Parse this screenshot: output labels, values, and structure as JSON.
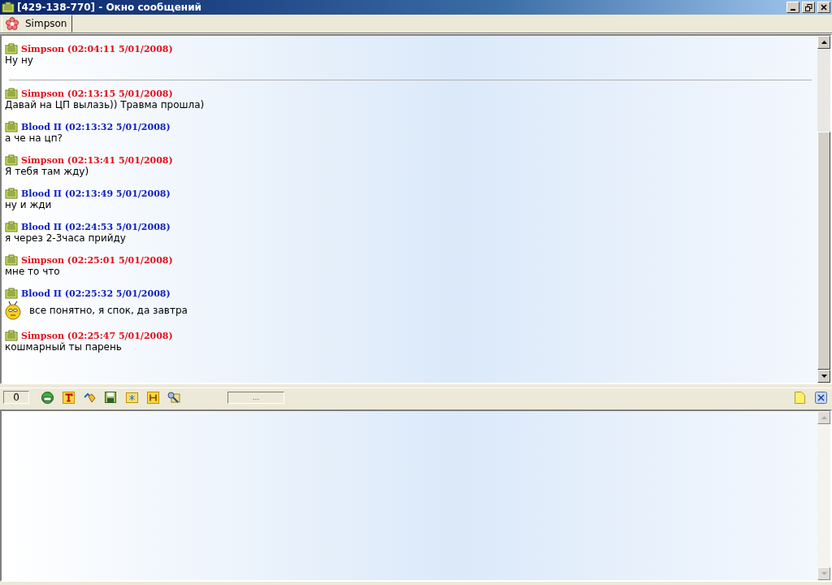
{
  "window": {
    "title": "[429-138-770] - Окно сообщений"
  },
  "tabs": [
    {
      "label": "Simpson",
      "selected": true
    }
  ],
  "messages": [
    {
      "kind": "message",
      "author": "Simpson (02:04:11 5/01/2008)",
      "color": "#e0101a",
      "text": "Ну ну",
      "smiley": false
    },
    {
      "kind": "divider"
    },
    {
      "kind": "message",
      "author": "Simpson (02:13:15 5/01/2008)",
      "color": "#e0101a",
      "text": "Давай на ЦП вылазь)) Травма прошла)",
      "smiley": false
    },
    {
      "kind": "message",
      "author": "Blood II (02:13:32 5/01/2008)",
      "color": "#1020c0",
      "text": "а че на цп?",
      "smiley": false
    },
    {
      "kind": "message",
      "author": "Simpson (02:13:41 5/01/2008)",
      "color": "#e0101a",
      "text": "Я тебя там жду)",
      "smiley": false
    },
    {
      "kind": "message",
      "author": "Blood II (02:13:49 5/01/2008)",
      "color": "#1020c0",
      "text": "ну и жди",
      "smiley": false
    },
    {
      "kind": "message",
      "author": "Blood II (02:24:53 5/01/2008)",
      "color": "#1020c0",
      "text": "я через 2-3часа прийду",
      "smiley": false
    },
    {
      "kind": "message",
      "author": "Simpson (02:25:01 5/01/2008)",
      "color": "#e0101a",
      "text": "мне то что",
      "smiley": false
    },
    {
      "kind": "message",
      "author": "Blood II (02:25:32 5/01/2008)",
      "color": "#1020c0",
      "text": "все понятно, я спок, да завтра",
      "smiley": true
    },
    {
      "kind": "message",
      "author": "Simpson (02:25:47 5/01/2008)",
      "color": "#e0101a",
      "text": "кошмарный ты парень",
      "smiley": false
    }
  ],
  "toolbar": {
    "counter": "0",
    "status": "..."
  }
}
